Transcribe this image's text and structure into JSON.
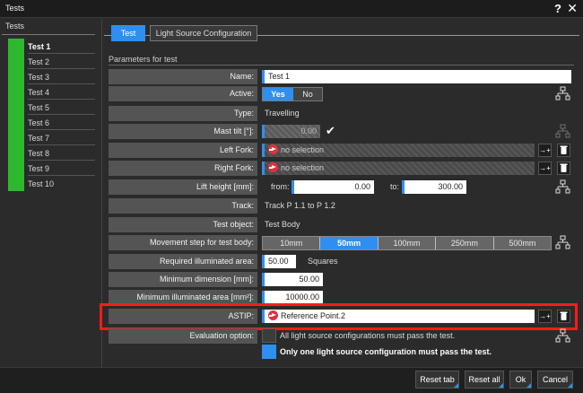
{
  "window": {
    "title": "Tests",
    "help": "?",
    "close": "✕"
  },
  "left": {
    "header": "Tests",
    "items": [
      "Test 1",
      "Test 2",
      "Test 3",
      "Test 4",
      "Test 5",
      "Test 6",
      "Test 7",
      "Test 8",
      "Test 9",
      "Test 10"
    ],
    "selected_index": 0,
    "status_color": "#2db82d"
  },
  "tabs": [
    {
      "label": "Test",
      "active": true
    },
    {
      "label": "Light Source Configuration",
      "active": false
    }
  ],
  "section_title": "Parameters for test",
  "fields": {
    "name": {
      "label": "Name:",
      "value": "Test 1"
    },
    "active": {
      "label": "Active:",
      "yes": "Yes",
      "no": "No",
      "selected": "Yes"
    },
    "type": {
      "label": "Type:",
      "value": "Travelling"
    },
    "mast_tilt": {
      "label": "Mast tilt [°]:",
      "value": "0.00"
    },
    "left_fork": {
      "label": "Left Fork:",
      "value": "no selection"
    },
    "right_fork": {
      "label": "Right Fork:",
      "value": "no selection"
    },
    "lift_height": {
      "label": "Lift height [mm]:",
      "from_label": "from:",
      "from_value": "0.00",
      "to_label": "to:",
      "to_value": "300.00"
    },
    "track": {
      "label": "Track:",
      "value": "Track P 1.1 to P 1.2"
    },
    "test_object": {
      "label": "Test object:",
      "value": "Test Body"
    },
    "movement_step": {
      "label": "Movement step for test body:",
      "options": [
        "10mm",
        "50mm",
        "100mm",
        "250mm",
        "500mm"
      ],
      "selected": "50mm"
    },
    "required_area": {
      "label": "Required illuminated area:",
      "value": "50.00",
      "unit": "Squares"
    },
    "min_dimension": {
      "label": "Minimum dimension [mm]:",
      "value": "50.00"
    },
    "min_area": {
      "label": "Minimum illuminated area [mm²]:",
      "value": "10000.00"
    },
    "astip": {
      "label": "ASTIP:",
      "value": "Reference Point.2"
    },
    "evaluation": {
      "label": "Evaluation option:",
      "option_all": "All light source configurations must pass the test.",
      "option_one": "Only one light source configuration must pass the test.",
      "selected": "option_one"
    }
  },
  "footer": {
    "reset_tab": "Reset tab",
    "reset_all": "Reset all",
    "ok": "Ok",
    "cancel": "Cancel"
  },
  "colors": {
    "accent": "#2f8ff0",
    "highlight": "#ff1a1a",
    "status_green": "#2db82d"
  },
  "icons": {
    "connect": "connect-arrows-icon",
    "delete": "trash-icon",
    "tree": "hierarchy-icon",
    "check": "checkmark-icon",
    "pick": "pick-arrow-icon"
  }
}
